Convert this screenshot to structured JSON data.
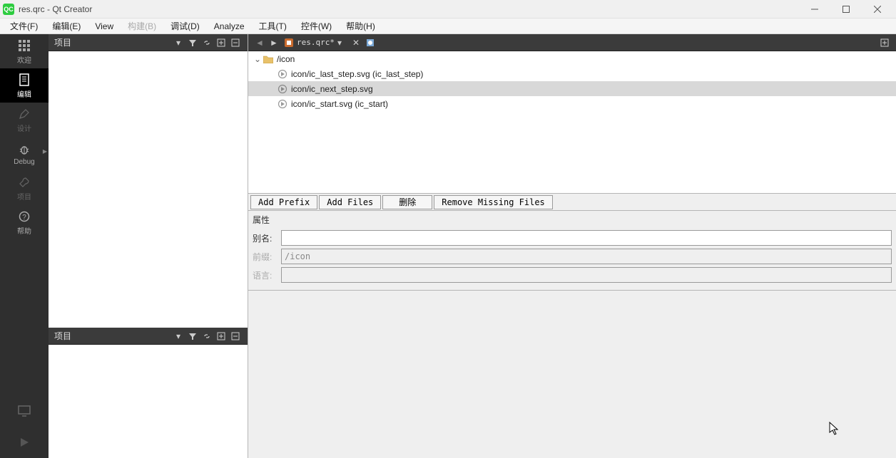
{
  "window": {
    "title": "res.qrc - Qt Creator"
  },
  "menu": {
    "file": "文件(F)",
    "edit": "编辑(E)",
    "view": "View",
    "build": "构建(B)",
    "debug": "调试(D)",
    "analyze": "Analyze",
    "tools": "工具(T)",
    "widgets": "控件(W)",
    "help": "帮助(H)"
  },
  "modes": {
    "welcome": "欢迎",
    "edit": "编辑",
    "design": "设计",
    "debug": "Debug",
    "projects": "项目",
    "help": "帮助"
  },
  "panes": {
    "project": "项目"
  },
  "editor": {
    "filename": "res.qrc*",
    "tree": {
      "root": "/icon",
      "items": [
        {
          "text": "icon/ic_last_step.svg (ic_last_step)",
          "selected": false
        },
        {
          "text": "icon/ic_next_step.svg",
          "selected": true
        },
        {
          "text": "icon/ic_start.svg (ic_start)",
          "selected": false
        }
      ]
    },
    "buttons": {
      "add_prefix": "Add Prefix",
      "add_files": "Add Files",
      "delete": "删除",
      "remove_missing": "Remove Missing Files"
    },
    "props": {
      "header": "属性",
      "alias_label": "别名:",
      "alias_value": "",
      "prefix_label": "前缀:",
      "prefix_value": "/icon",
      "lang_label": "语言:",
      "lang_value": ""
    }
  }
}
